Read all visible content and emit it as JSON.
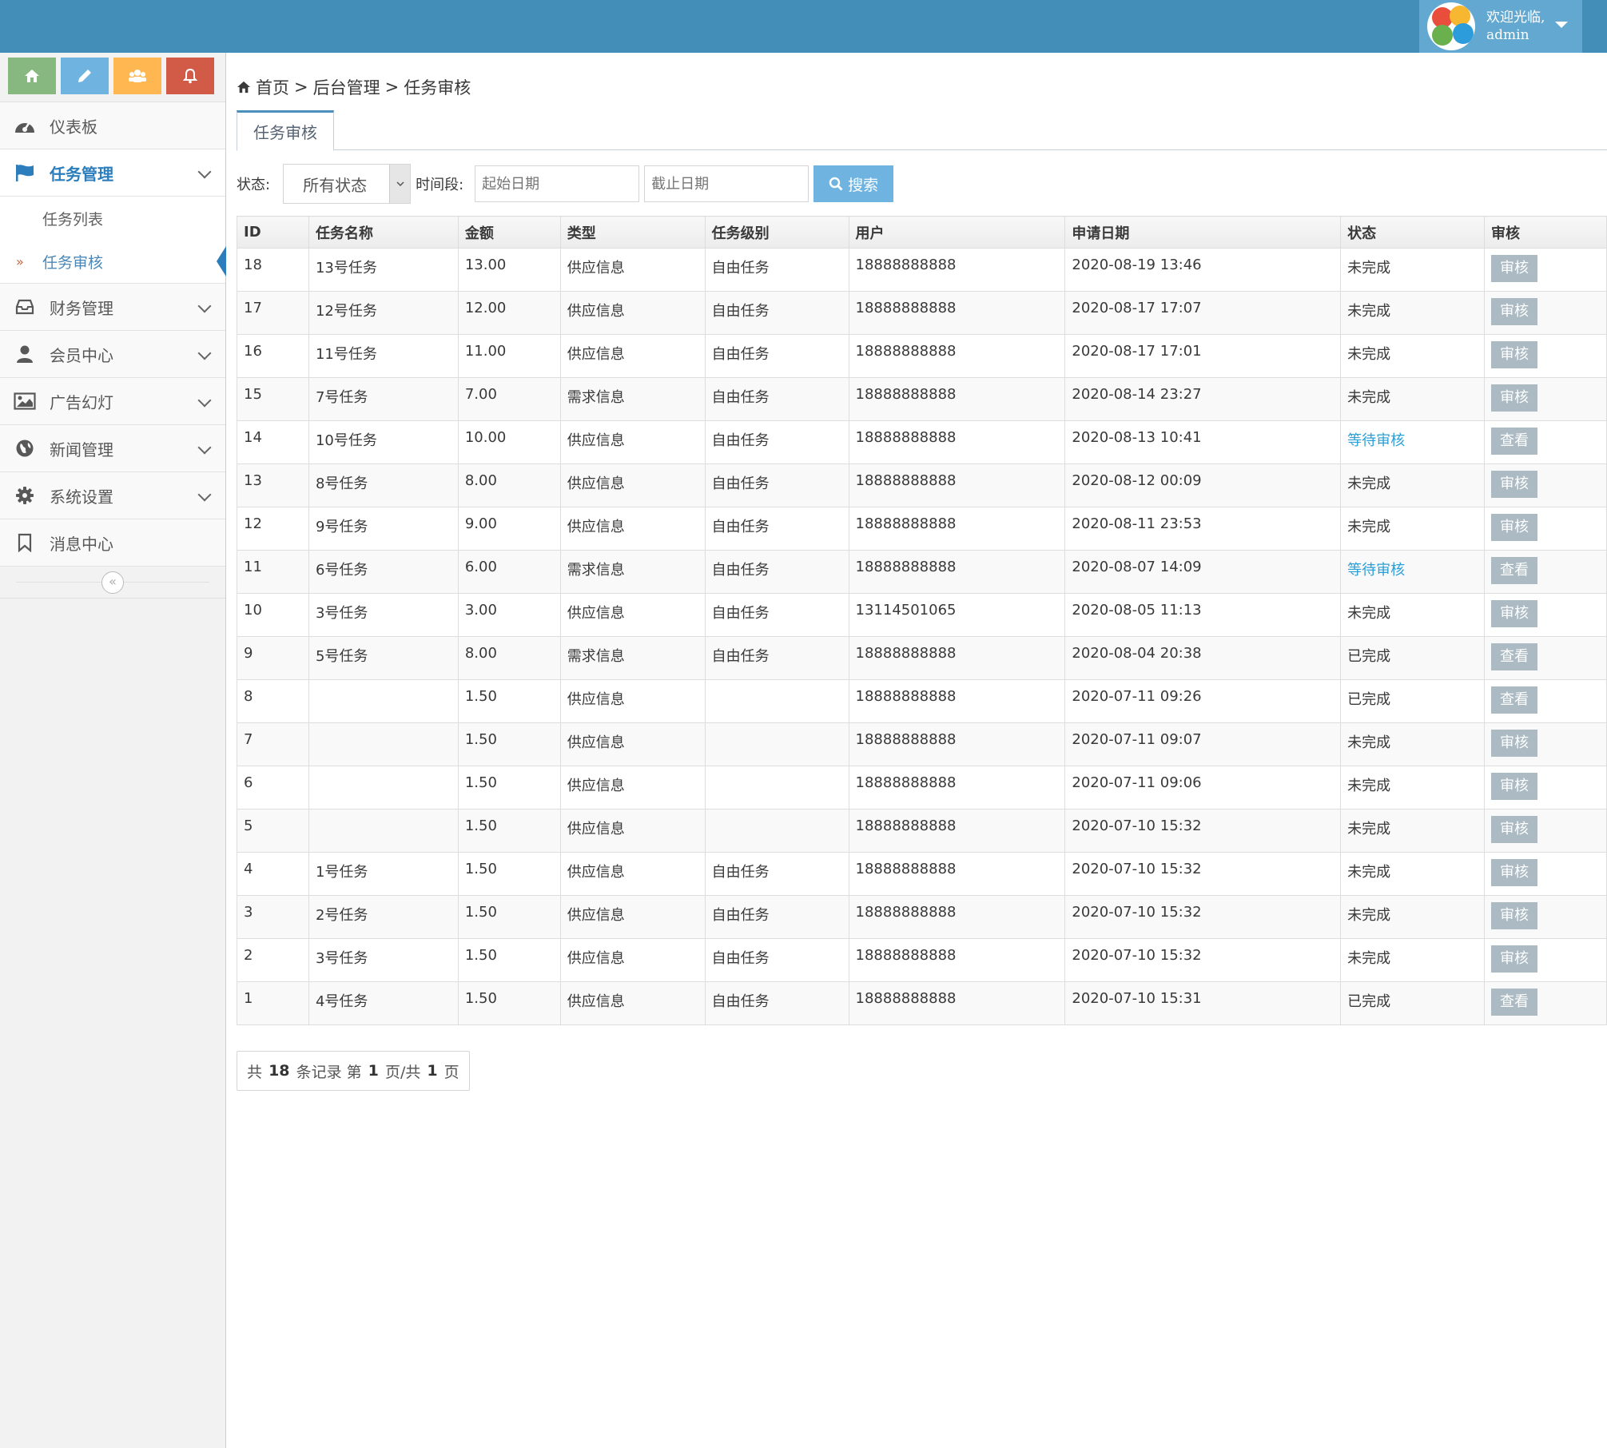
{
  "user": {
    "greeting": "欢迎光临,",
    "name": "admin"
  },
  "shortcut_colors": [
    "#87b87f",
    "#6fb3e0",
    "#ffb752",
    "#d15b47"
  ],
  "sidebar": {
    "items": [
      {
        "label": "仪表板",
        "icon": "dashboard-icon"
      },
      {
        "label": "任务管理",
        "icon": "flag-icon",
        "active": true
      },
      {
        "label": "财务管理",
        "icon": "inbox-icon"
      },
      {
        "label": "会员中心",
        "icon": "user-icon"
      },
      {
        "label": "广告幻灯",
        "icon": "picture-icon"
      },
      {
        "label": "新闻管理",
        "icon": "globe-icon"
      },
      {
        "label": "系统设置",
        "icon": "gear-icon"
      },
      {
        "label": "消息中心",
        "icon": "bookmark-icon"
      }
    ],
    "submenu": [
      {
        "label": "任务列表"
      },
      {
        "label": "任务审核",
        "active": true
      }
    ]
  },
  "breadcrumb": {
    "home": "首页",
    "sep": ">",
    "level2": "后台管理",
    "current": "任务审核"
  },
  "tab": {
    "label": "任务审核"
  },
  "filter": {
    "status_label": "状态:",
    "status_value": "所有状态",
    "period_label": "时间段:",
    "start_placeholder": "起始日期",
    "end_placeholder": "截止日期",
    "search_label": "搜索"
  },
  "table": {
    "headers": [
      "ID",
      "任务名称",
      "金额",
      "类型",
      "任务级别",
      "用户",
      "申请日期",
      "状态",
      "审核"
    ],
    "rows": [
      [
        "18",
        "13号任务",
        "13.00",
        "供应信息",
        "自由任务",
        "18888888888",
        "2020-08-19 13:46",
        "未完成",
        "审核"
      ],
      [
        "17",
        "12号任务",
        "12.00",
        "供应信息",
        "自由任务",
        "18888888888",
        "2020-08-17 17:07",
        "未完成",
        "审核"
      ],
      [
        "16",
        "11号任务",
        "11.00",
        "供应信息",
        "自由任务",
        "18888888888",
        "2020-08-17 17:01",
        "未完成",
        "审核"
      ],
      [
        "15",
        "7号任务",
        "7.00",
        "需求信息",
        "自由任务",
        "18888888888",
        "2020-08-14 23:27",
        "未完成",
        "审核"
      ],
      [
        "14",
        "10号任务",
        "10.00",
        "供应信息",
        "自由任务",
        "18888888888",
        "2020-08-13 10:41",
        "等待审核",
        "查看"
      ],
      [
        "13",
        "8号任务",
        "8.00",
        "供应信息",
        "自由任务",
        "18888888888",
        "2020-08-12 00:09",
        "未完成",
        "审核"
      ],
      [
        "12",
        "9号任务",
        "9.00",
        "供应信息",
        "自由任务",
        "18888888888",
        "2020-08-11 23:53",
        "未完成",
        "审核"
      ],
      [
        "11",
        "6号任务",
        "6.00",
        "需求信息",
        "自由任务",
        "18888888888",
        "2020-08-07 14:09",
        "等待审核",
        "查看"
      ],
      [
        "10",
        "3号任务",
        "3.00",
        "供应信息",
        "自由任务",
        "13114501065",
        "2020-08-05 11:13",
        "未完成",
        "审核"
      ],
      [
        "9",
        "5号任务",
        "8.00",
        "需求信息",
        "自由任务",
        "18888888888",
        "2020-08-04 20:38",
        "已完成",
        "查看"
      ],
      [
        "8",
        "",
        "1.50",
        "供应信息",
        "",
        "18888888888",
        "2020-07-11 09:26",
        "已完成",
        "查看"
      ],
      [
        "7",
        "",
        "1.50",
        "供应信息",
        "",
        "18888888888",
        "2020-07-11 09:07",
        "未完成",
        "审核"
      ],
      [
        "6",
        "",
        "1.50",
        "供应信息",
        "",
        "18888888888",
        "2020-07-11 09:06",
        "未完成",
        "审核"
      ],
      [
        "5",
        "",
        "1.50",
        "供应信息",
        "",
        "18888888888",
        "2020-07-10 15:32",
        "未完成",
        "审核"
      ],
      [
        "4",
        "1号任务",
        "1.50",
        "供应信息",
        "自由任务",
        "18888888888",
        "2020-07-10 15:32",
        "未完成",
        "审核"
      ],
      [
        "3",
        "2号任务",
        "1.50",
        "供应信息",
        "自由任务",
        "18888888888",
        "2020-07-10 15:32",
        "未完成",
        "审核"
      ],
      [
        "2",
        "3号任务",
        "1.50",
        "供应信息",
        "自由任务",
        "18888888888",
        "2020-07-10 15:32",
        "未完成",
        "审核"
      ],
      [
        "1",
        "4号任务",
        "1.50",
        "供应信息",
        "自由任务",
        "18888888888",
        "2020-07-10 15:31",
        "已完成",
        "查看"
      ]
    ]
  },
  "pager": {
    "p1": "共",
    "total": "18",
    "p2": "条记录 第",
    "page": "1",
    "p3": "页/共",
    "pages": "1",
    "p4": "页"
  }
}
